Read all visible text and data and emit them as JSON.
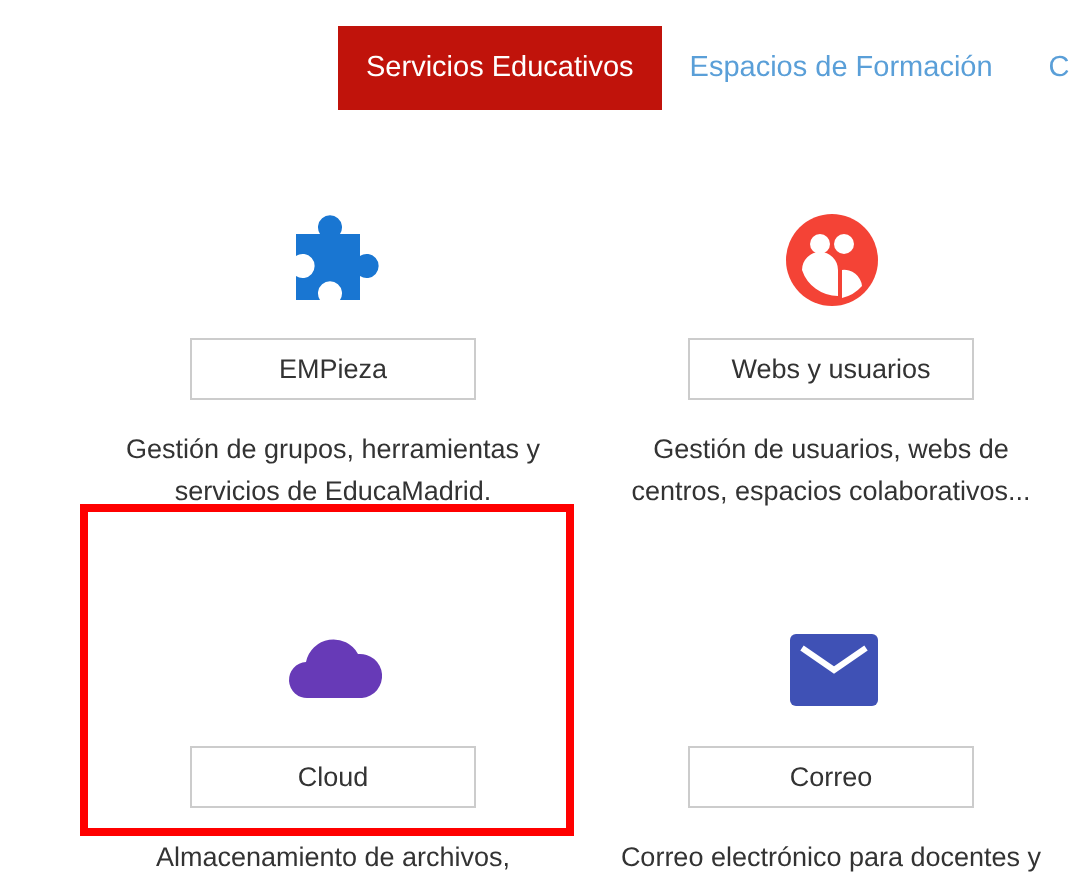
{
  "tabs": [
    {
      "label": "Servicios Educativos",
      "selected": true
    },
    {
      "label": "Espacios de Formación",
      "selected": false
    },
    {
      "label": "C",
      "selected": false
    }
  ],
  "services": [
    {
      "kind": "puzzle",
      "color": "#1976d2",
      "button": "EMPieza",
      "description": "Gestión de grupos, herramientas y servicios de EducaMadrid.",
      "highlighted": false
    },
    {
      "kind": "people",
      "color": "#f44336",
      "button": "Webs y usuarios",
      "description": "Gestión de usuarios, webs de centros, espacios colaborativos...",
      "highlighted": false
    },
    {
      "kind": "cloud",
      "color": "#673ab7",
      "button": "Cloud",
      "description": "Almacenamiento de archivos,",
      "highlighted": true
    },
    {
      "kind": "mail",
      "color": "#3f51b5",
      "button": "Correo",
      "description": "Correo electrónico para docentes y",
      "highlighted": false
    }
  ]
}
